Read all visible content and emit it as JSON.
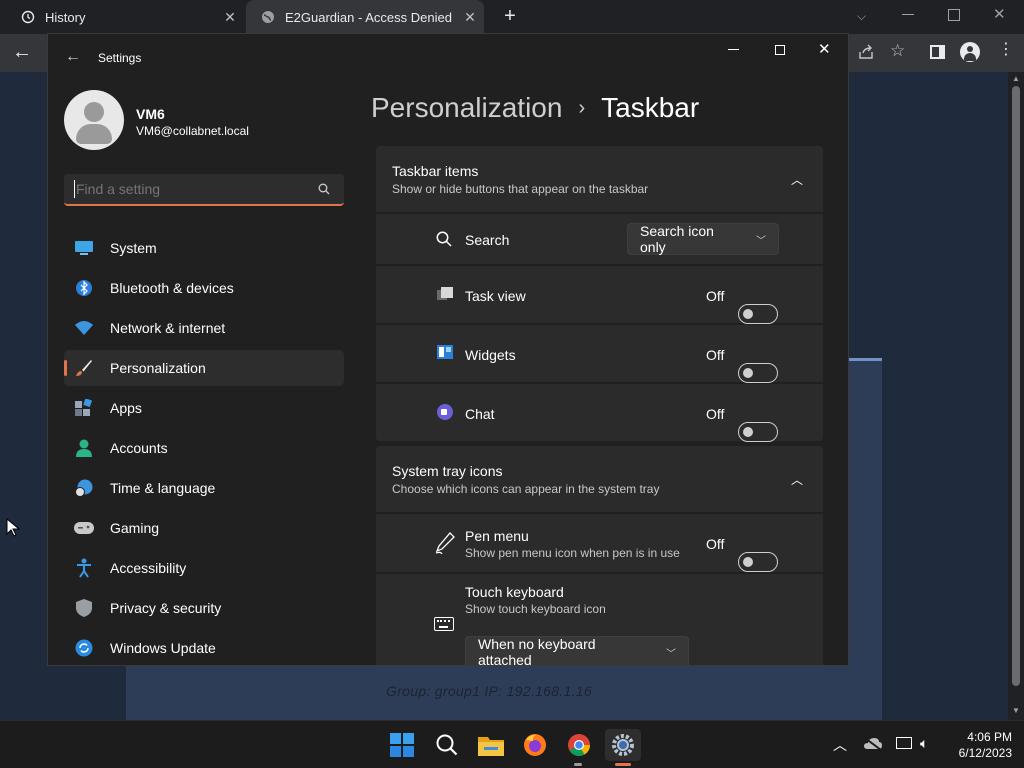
{
  "browser": {
    "tabs": [
      {
        "title": "History",
        "icon": "history-icon"
      },
      {
        "title": "E2Guardian - Access Denied",
        "icon": "globe-icon"
      }
    ],
    "new_tab": "+",
    "page_text": "Group: group1   IP: 192.168.1.16"
  },
  "settings": {
    "window_title": "Settings",
    "user": {
      "name": "VM6",
      "email": "VM6@collabnet.local"
    },
    "search": {
      "placeholder": "Find a setting"
    },
    "nav": [
      {
        "label": "System",
        "icon": "system-icon",
        "selected": false
      },
      {
        "label": "Bluetooth & devices",
        "icon": "bluetooth-icon",
        "selected": false
      },
      {
        "label": "Network & internet",
        "icon": "wifi-icon",
        "selected": false
      },
      {
        "label": "Personalization",
        "icon": "brush-icon",
        "selected": true
      },
      {
        "label": "Apps",
        "icon": "apps-icon",
        "selected": false
      },
      {
        "label": "Accounts",
        "icon": "accounts-icon",
        "selected": false
      },
      {
        "label": "Time & language",
        "icon": "time-language-icon",
        "selected": false
      },
      {
        "label": "Gaming",
        "icon": "gamepad-icon",
        "selected": false
      },
      {
        "label": "Accessibility",
        "icon": "accessibility-icon",
        "selected": false
      },
      {
        "label": "Privacy & security",
        "icon": "shield-icon",
        "selected": false
      },
      {
        "label": "Windows Update",
        "icon": "update-icon",
        "selected": false
      }
    ],
    "breadcrumb": {
      "parent": "Personalization",
      "separator": "›",
      "current": "Taskbar"
    },
    "taskbar_items": {
      "title": "Taskbar items",
      "subtitle": "Show or hide buttons that appear on the taskbar",
      "rows": [
        {
          "label": "Search",
          "dropdown": "Search icon only"
        },
        {
          "label": "Task view",
          "state": "Off"
        },
        {
          "label": "Widgets",
          "state": "Off"
        },
        {
          "label": "Chat",
          "state": "Off"
        }
      ]
    },
    "system_tray": {
      "title": "System tray icons",
      "subtitle": "Choose which icons can appear in the system tray",
      "pen": {
        "label": "Pen menu",
        "sub": "Show pen menu icon when pen is in use",
        "state": "Off"
      },
      "touch": {
        "label": "Touch keyboard",
        "sub": "Show touch keyboard icon",
        "dropdown": "When no keyboard attached"
      }
    }
  },
  "taskbar": {
    "time": "4:06 PM",
    "date": "6/12/2023"
  },
  "colors": {
    "accent": "#e0744a",
    "window_bg": "#202020",
    "card_bg": "#2b2b2b"
  }
}
